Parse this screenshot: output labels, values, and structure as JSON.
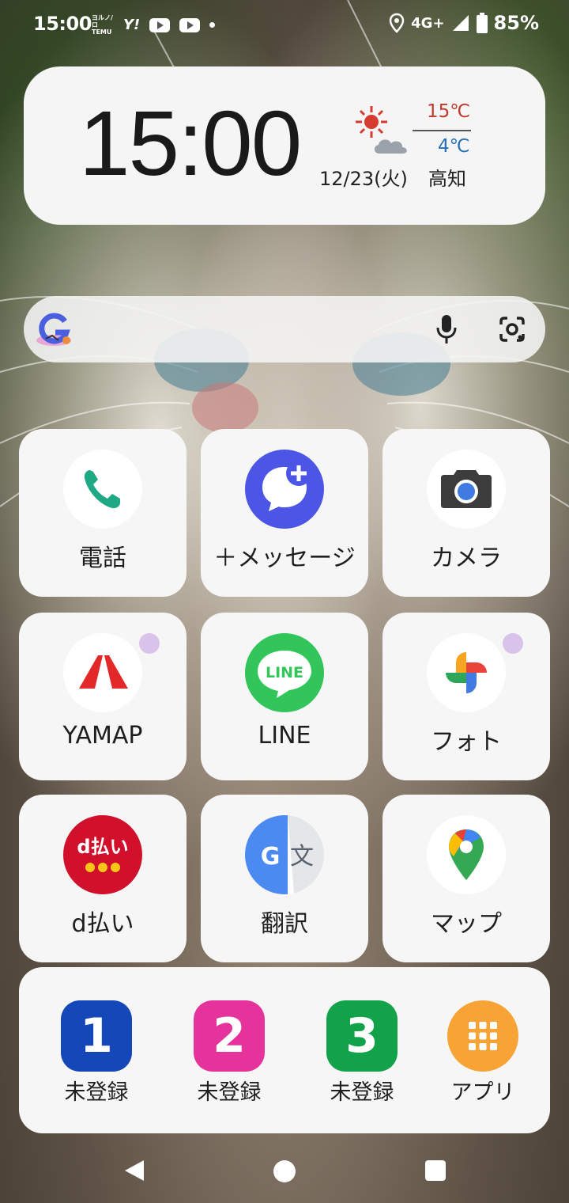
{
  "status_bar": {
    "time": "15:00",
    "notif_temu": "ヨルノ/ロ TEMU",
    "notif_yahoo": "Y!",
    "network": "4G+",
    "battery": "85%"
  },
  "clock_widget": {
    "time": "15:00",
    "date": "12/23(火)",
    "city": "高知",
    "temp_high": "15℃",
    "temp_low": "4℃",
    "weather_icon": "sun-and-cloud-icon"
  },
  "search": {
    "icons": [
      "google-g-icon",
      "mic-icon",
      "lens-icon"
    ]
  },
  "apps": [
    {
      "label": "電話",
      "icon": "phone-icon"
    },
    {
      "label": "＋メッセージ",
      "icon": "plus-message-icon"
    },
    {
      "label": "カメラ",
      "icon": "camera-icon"
    },
    {
      "label": "YAMAP",
      "icon": "yamap-icon"
    },
    {
      "label": "LINE",
      "icon": "line-icon",
      "icon_text": "LINE"
    },
    {
      "label": "フォト",
      "icon": "photos-icon"
    },
    {
      "label": "d払い",
      "icon": "d-barai-icon",
      "icon_text": "d払い"
    },
    {
      "label": "翻訳",
      "icon": "translate-icon",
      "icon_text_1": "G",
      "icon_text_2": "文"
    },
    {
      "label": "マップ",
      "icon": "maps-icon"
    }
  ],
  "dock": [
    {
      "number": "1",
      "label": "未登録",
      "color": "#1447b8"
    },
    {
      "number": "2",
      "label": "未登録",
      "color": "#e6339b"
    },
    {
      "number": "3",
      "label": "未登録",
      "color": "#12a34a"
    },
    {
      "label": "アプリ",
      "color": "#f7a336",
      "icon": "app-grid-icon"
    }
  ],
  "colors": {
    "temp_high": "#c0392b",
    "temp_low": "#2471b8",
    "tile_bg": "#f6f6f6"
  }
}
